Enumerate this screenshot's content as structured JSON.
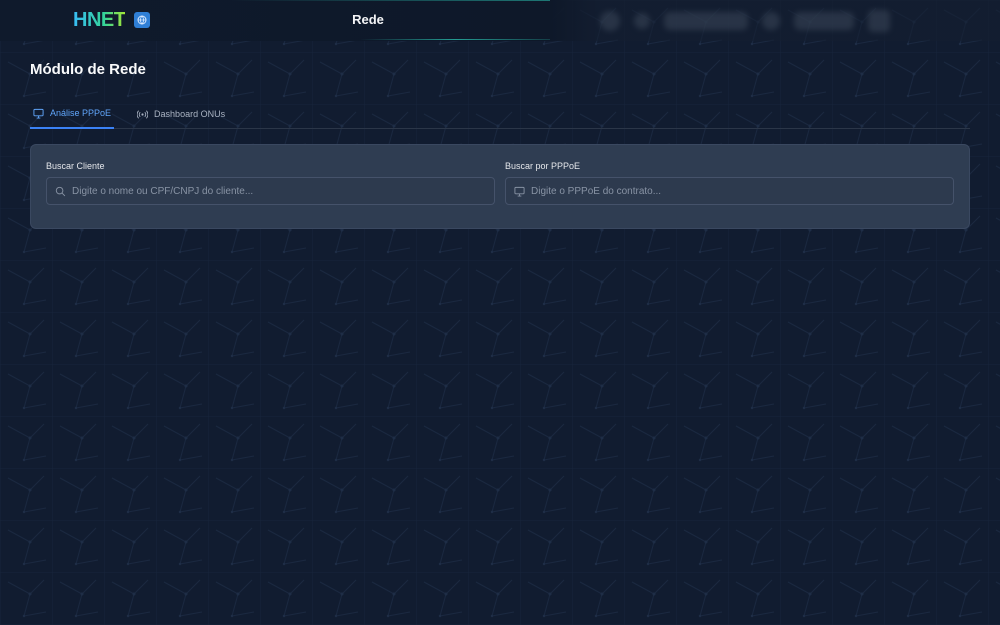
{
  "header": {
    "logo_text": "HNET",
    "title": "Rede"
  },
  "page": {
    "title": "Módulo de Rede",
    "tabs": [
      {
        "label": "Análise PPPoE",
        "icon": "monitor-icon",
        "active": true
      },
      {
        "label": "Dashboard ONUs",
        "icon": "radio-signal-icon",
        "active": false
      }
    ]
  },
  "search": {
    "client": {
      "label": "Buscar Cliente",
      "placeholder": "Digite o nome ou CPF/CNPJ do cliente...",
      "value": "",
      "icon": "search-icon"
    },
    "pppoe": {
      "label": "Buscar por PPPoE",
      "placeholder": "Digite o PPPoE do contrato...",
      "value": "",
      "icon": "monitor-icon"
    }
  },
  "colors": {
    "background": "#111c30",
    "card": "#2f3d52",
    "accent": "#3b82f6",
    "accent_text": "#60a5fa",
    "logo_gradient_start": "#38bdf8",
    "logo_gradient_end": "#a3e635"
  }
}
